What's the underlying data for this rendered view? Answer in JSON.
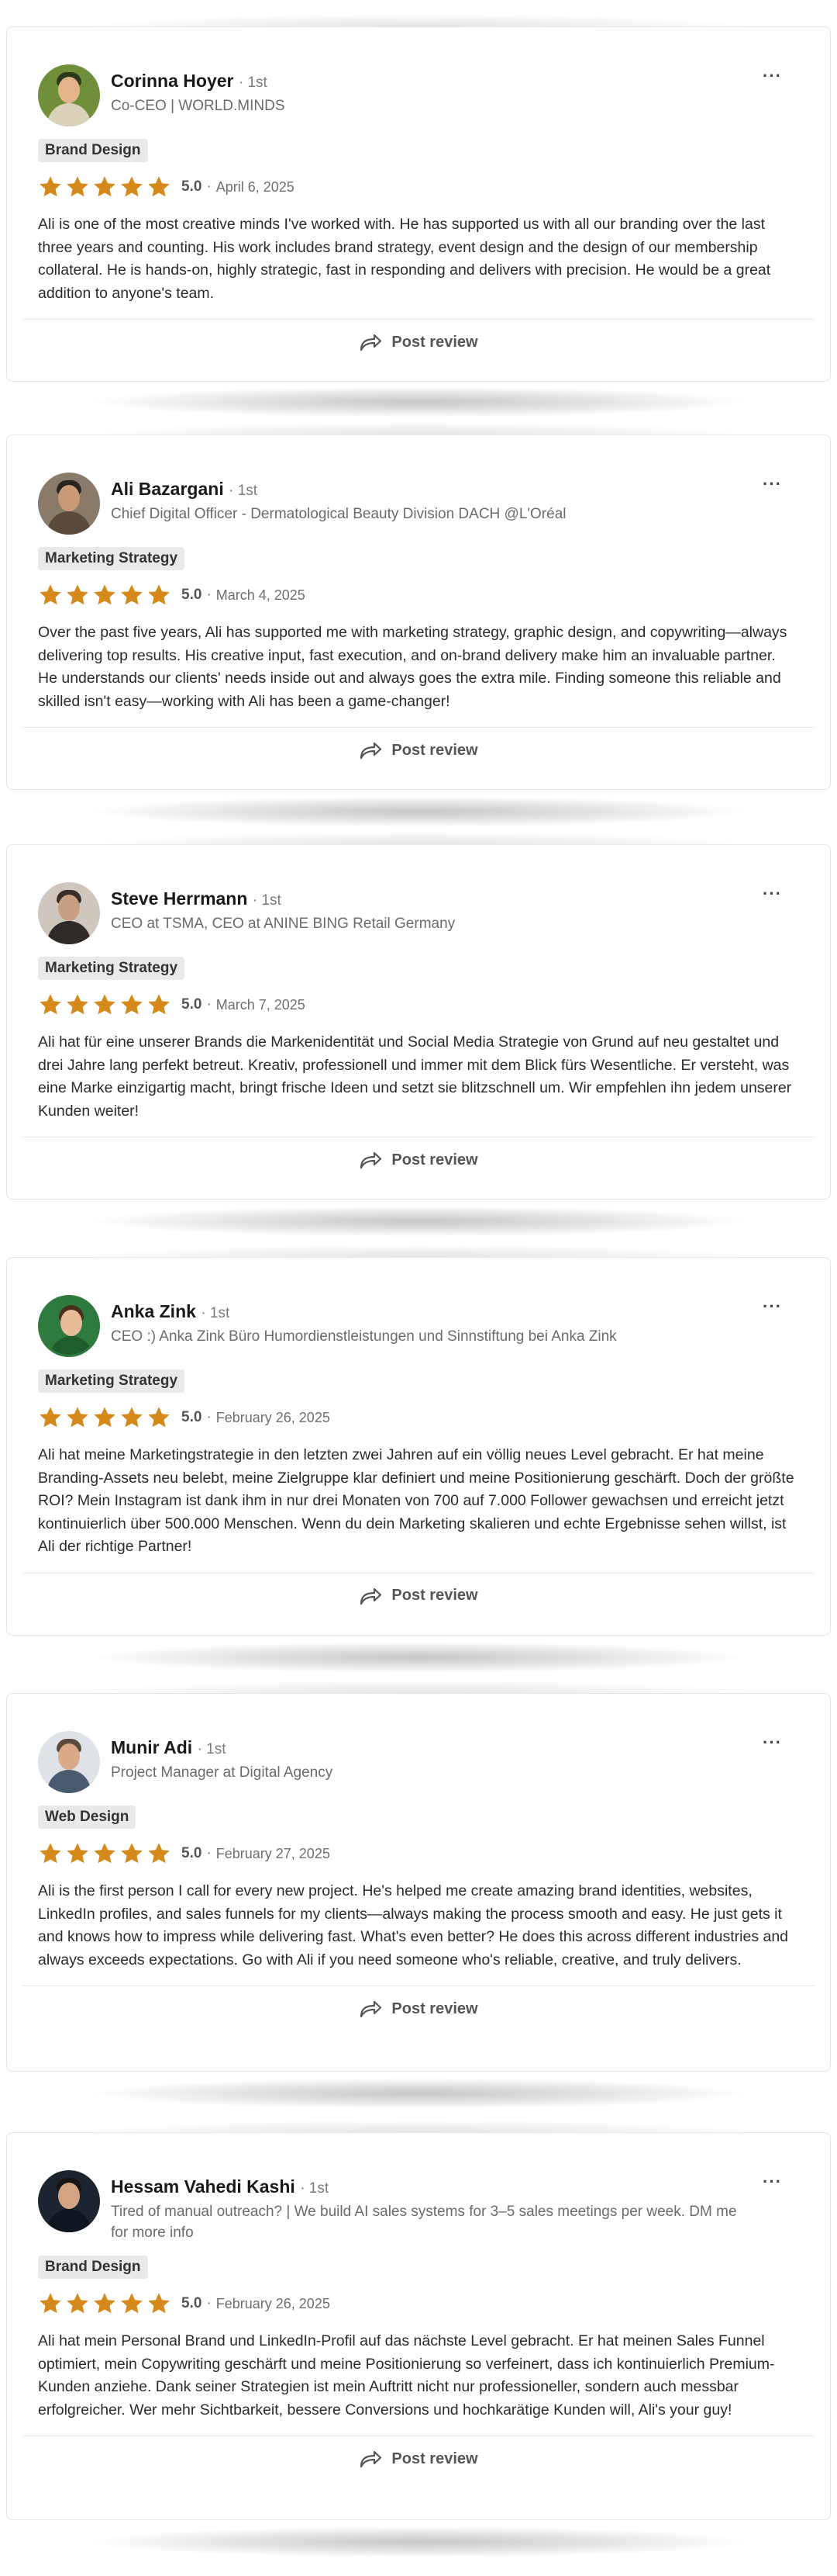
{
  "ui": {
    "more_glyph": "···",
    "post_review_label": "Post review",
    "dot": "·",
    "star_color": "#d4891a",
    "reply_icon": "share-arrow-icon"
  },
  "reviews": [
    {
      "name": "Corinna Hoyer",
      "degree": "· 1st",
      "headline": "Co-CEO | WORLD.MINDS",
      "tag": "Brand Design",
      "score": "5.0",
      "date": "April 6, 2025",
      "stars": 5,
      "text": "Ali is one of the most creative minds I've worked with. He has supported us with all our branding over the last three years and counting. His work includes brand strategy, event design and the design of our membership collateral. He is hands-on, highly strategic, fast in responding and delivers with precision. He would be a great addition to anyone's team."
    },
    {
      "name": "Ali Bazargani",
      "degree": "· 1st",
      "headline": "Chief Digital Officer - Dermatological Beauty Division DACH @L'Oréal",
      "tag": "Marketing Strategy",
      "score": "5.0",
      "date": "March 4, 2025",
      "stars": 5,
      "text": "Over the past five years, Ali has supported me with marketing strategy, graphic design, and copywriting—always delivering top results. His creative input, fast execution, and on-brand delivery make him an invaluable partner. He understands our clients' needs inside out and always goes the extra mile. Finding someone this reliable and skilled isn't easy—working with Ali has been a game-changer!"
    },
    {
      "name": "Steve Herrmann",
      "degree": "· 1st",
      "headline": "CEO at TSMA, CEO at ANINE BING Retail Germany",
      "tag": "Marketing Strategy",
      "score": "5.0",
      "date": "March 7, 2025",
      "stars": 5,
      "text": "Ali hat für eine unserer Brands die Markenidentität und Social Media Strategie von Grund auf neu gestaltet und drei Jahre lang perfekt betreut. Kreativ, professionell und immer mit dem Blick fürs Wesentliche. Er versteht, was eine Marke einzigartig macht, bringt frische Ideen und setzt sie blitzschnell um. Wir empfehlen ihn jedem unserer Kunden weiter!"
    },
    {
      "name": "Anka Zink",
      "degree": "· 1st",
      "headline": "CEO :) Anka Zink Büro Humordienstleistungen und Sinnstiftung bei Anka Zink",
      "tag": "Marketing Strategy",
      "score": "5.0",
      "date": "February 26, 2025",
      "stars": 5,
      "text": "Ali hat meine Marketingstrategie in den letzten zwei Jahren auf ein völlig neues Level gebracht. Er hat meine Branding-Assets neu belebt, meine Zielgruppe klar definiert und meine Positionierung geschärft. Doch der größte ROI? Mein Instagram ist dank ihm in nur drei Monaten von 700 auf 7.000 Follower gewachsen und erreicht jetzt kontinuierlich über 500.000 Menschen. Wenn du dein Marketing skalieren und echte Ergebnisse sehen willst, ist Ali der richtige Partner!"
    },
    {
      "name": "Munir Adi",
      "degree": "· 1st",
      "headline": "Project Manager at Digital Agency",
      "tag": "Web Design",
      "score": "5.0",
      "date": "February 27, 2025",
      "stars": 5,
      "text": "Ali is the first person I call for every new project. He's helped me create amazing brand identities, websites, LinkedIn profiles, and sales funnels for my clients—always making the process smooth and easy. He just gets it and knows how to impress while delivering fast. What's even better? He does this across different industries and always exceeds expectations. Go with Ali if you need someone who's reliable, creative, and truly delivers."
    },
    {
      "name": "Hessam Vahedi Kashi",
      "degree": "· 1st",
      "headline": "Tired of manual outreach? | We build AI sales systems for 3–5 sales meetings per week. DM me for more info",
      "tag": "Brand Design",
      "score": "5.0",
      "date": "February 26, 2025",
      "stars": 5,
      "text": "Ali hat mein Personal Brand und LinkedIn-Profil auf das nächste Level gebracht. Er hat meinen Sales Funnel optimiert, mein Copywriting geschärft und meine Positionierung so verfeinert, dass ich kontinuierlich Premium-Kunden anziehe. Dank seiner Strategien ist mein Auftritt nicht nur professioneller, sondern auch messbar erfolgreicher. Wer mehr Sichtbarkeit, bessere Conversions und hochkarätige Kunden will, Ali's your guy!"
    }
  ]
}
